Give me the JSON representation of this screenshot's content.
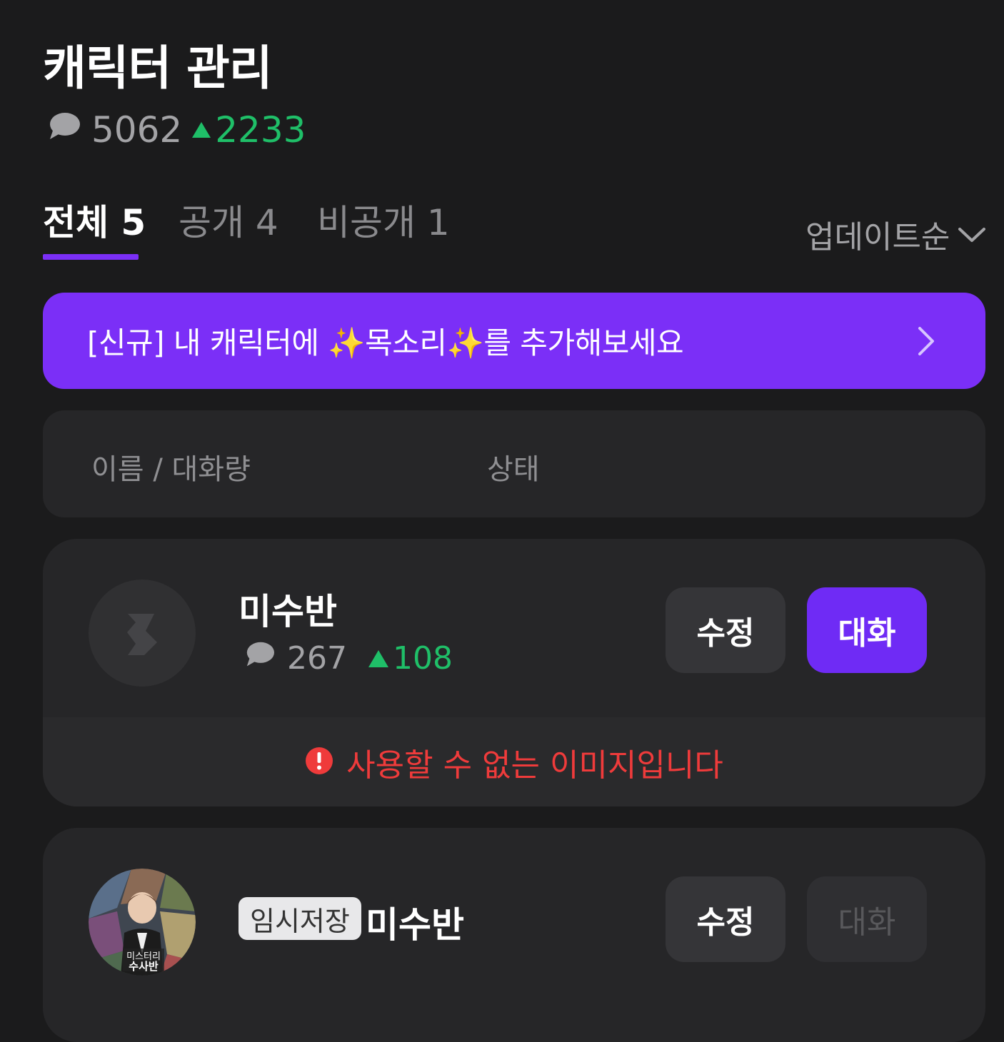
{
  "header": {
    "title": "캐릭터 관리",
    "chat_count": "5062",
    "chat_delta": "2233"
  },
  "tabs": [
    {
      "label": "전체 5"
    },
    {
      "label": "공개 4"
    },
    {
      "label": "비공개 1"
    }
  ],
  "sort": {
    "label": "업데이트순"
  },
  "banner": {
    "text": "[신규] 내 캐릭터에 ✨목소리✨를 추가해보세요"
  },
  "table_header": {
    "name_col": "이름 / 대화량",
    "status_col": "상태"
  },
  "characters": [
    {
      "name": "미수반",
      "chat_count": "267",
      "chat_delta": "108",
      "edit_label": "수정",
      "chat_label": "대화",
      "error": "사용할 수 없는 이미지입니다"
    },
    {
      "badge": "임시저장",
      "name": "미수반",
      "edit_label": "수정",
      "chat_label": "대화",
      "avatar_text_1": "미스터리",
      "avatar_text_2": "수사반"
    }
  ],
  "colors": {
    "background": "#1b1b1c",
    "accent": "#7b2ff7",
    "positive": "#1fbf68",
    "error": "#ef3b3b"
  }
}
